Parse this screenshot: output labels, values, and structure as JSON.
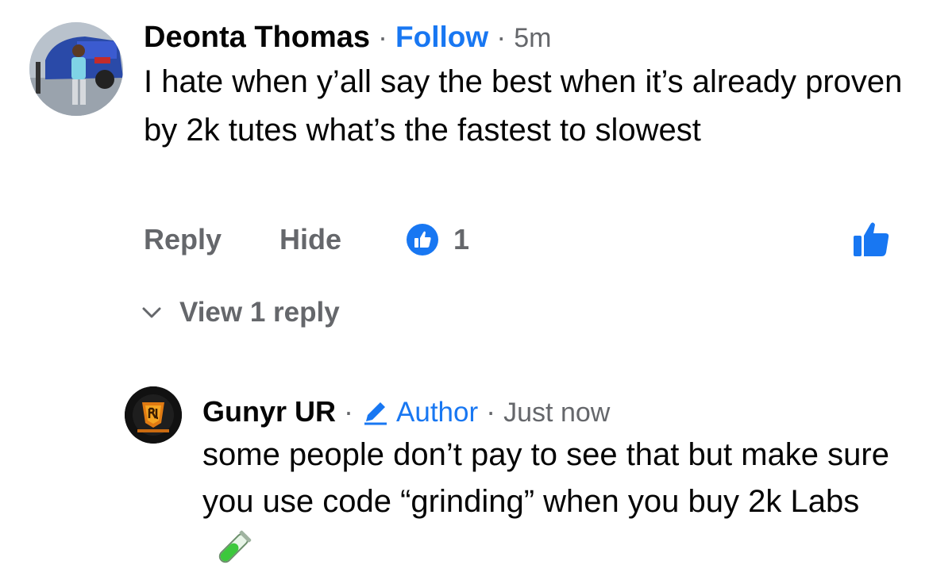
{
  "comment": {
    "author": "Deonta Thomas",
    "follow_label": "Follow",
    "time": "5m",
    "text": "I hate when y’all say the best when it’s already proven by 2k tutes what’s the fastest to slowest",
    "actions": {
      "reply": "Reply",
      "hide": "Hide",
      "like_count": "1"
    },
    "view_replies": "View 1 reply"
  },
  "reply": {
    "author": "Gunyr UR",
    "badge": "Author",
    "time": "Just now",
    "text": "some people don’t pay to see that but make sure you use code “grinding” when you buy 2k Labs",
    "emoji": "test-tube-icon"
  },
  "colors": {
    "accent": "#1877f2",
    "muted": "#65676b",
    "text": "#050505"
  },
  "separator": "·"
}
